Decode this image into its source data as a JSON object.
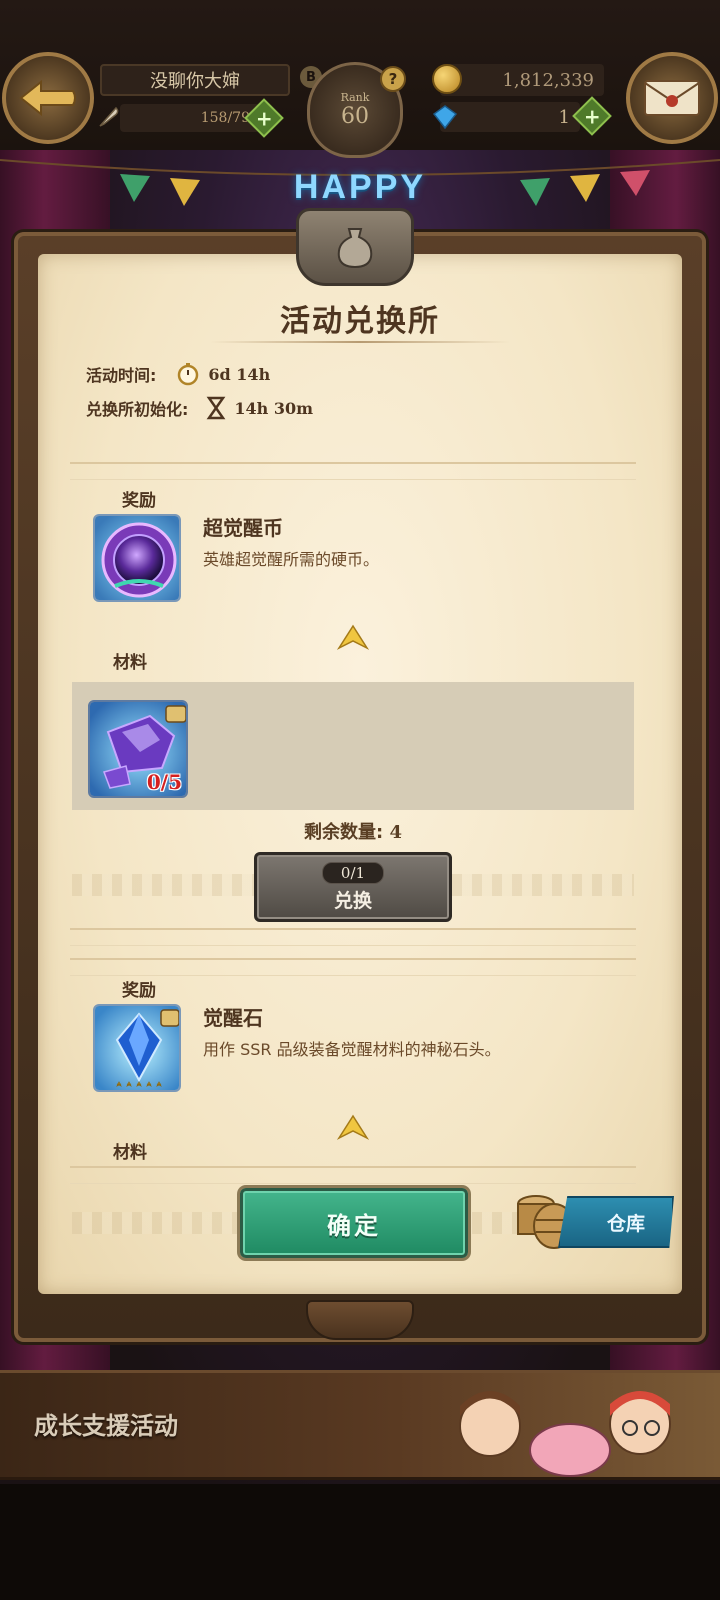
{
  "player": {
    "name": "没聊你大婶",
    "stamina": "158/79",
    "rank_label": "Rank",
    "rank_level": "60",
    "gold": "1,812,339",
    "gems": "1"
  },
  "scene": {
    "banner_word": "HAPPY"
  },
  "dialog": {
    "title": "活动兑换所",
    "event_time_label": "活动时间:",
    "event_time_value": "6d 14h",
    "reset_label": "兑换所初始化:",
    "reset_value": "14h 30m",
    "reward_label": "奖励",
    "material_label": "材料",
    "entries": [
      {
        "name": "超觉醒币",
        "description": "英雄超觉醒所需的硬币。",
        "material_qty": "0/5",
        "remaining_label": "剩余数量:",
        "remaining_value": "4",
        "exchange_count": "0/1",
        "exchange_label": "兑换"
      },
      {
        "name": "觉醒石",
        "description": "用作 SSR 品级装备觉醒材料的神秘石头。"
      }
    ],
    "confirm_label": "确定",
    "storage_label": "仓库"
  },
  "bottom_banner": {
    "title": "成长支援活动"
  }
}
